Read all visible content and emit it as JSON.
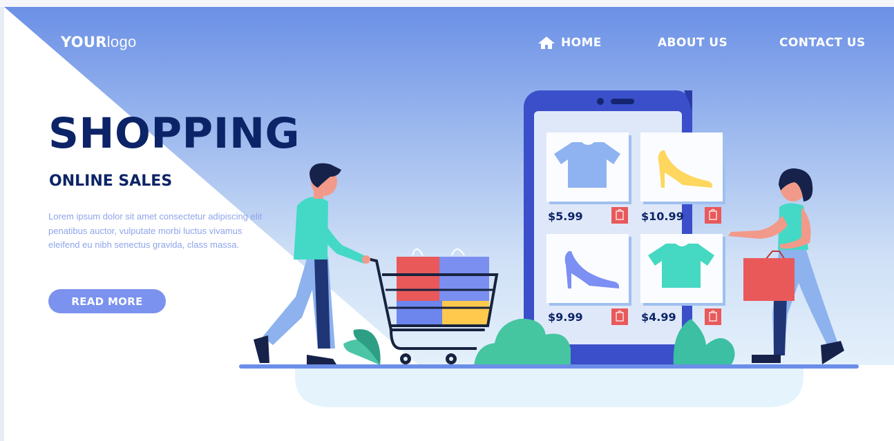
{
  "header": {
    "logo_bold": "YOUR",
    "logo_light": "logo",
    "nav": {
      "home": "HOME",
      "about": "ABOUT US",
      "contact": "CONTACT US"
    }
  },
  "hero": {
    "title": "SHOPPING",
    "subtitle": "ONLINE SALES",
    "body": "Lorem ipsum dolor sit amet consectetur adipiscing elit penatibus auctor, vulputate morbi luctus vivamus eleifend eu nibh senectus gravida, class massa.",
    "cta": "READ MORE"
  },
  "products": [
    {
      "icon": "tshirt-icon",
      "price": "$5.99"
    },
    {
      "icon": "high-heel-icon",
      "price": "$10.99"
    },
    {
      "icon": "high-heel-icon",
      "price": "$9.99"
    },
    {
      "icon": "tshirt-icon",
      "price": "$4.99"
    }
  ],
  "colors": {
    "navy": "#0c2467",
    "accent": "#7b92ef",
    "phone": "#3a4fc9",
    "teal": "#43d9c6",
    "red_bag": "#e9595a",
    "yellow": "#ffd65e"
  }
}
